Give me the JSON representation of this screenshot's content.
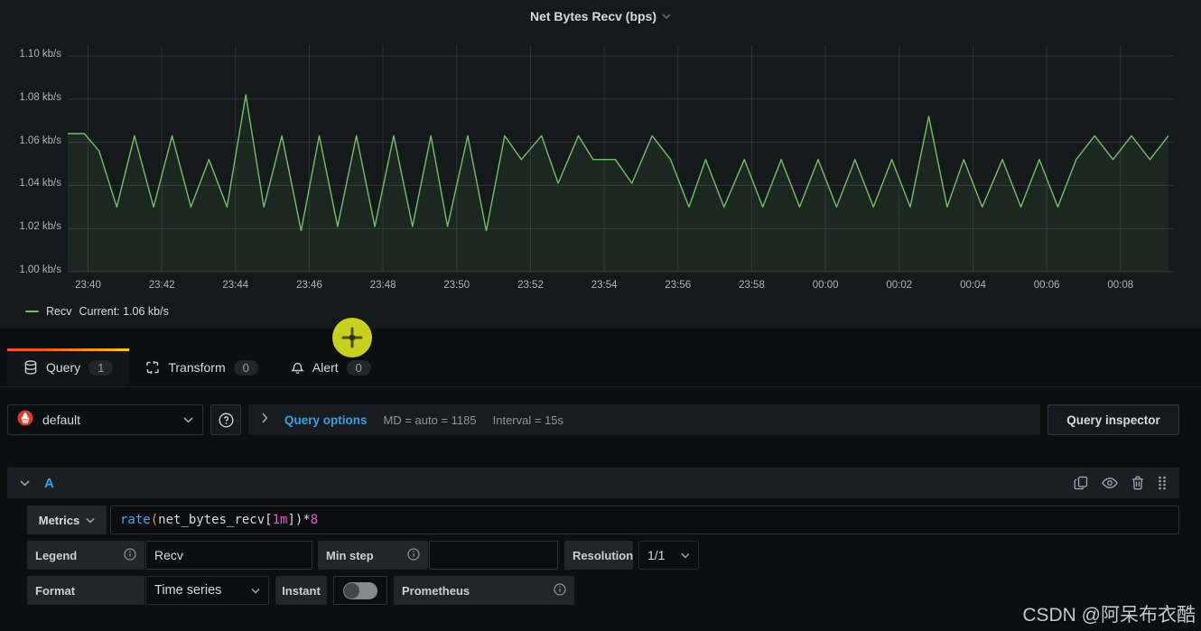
{
  "panel": {
    "title": "Net Bytes Recv (bps)",
    "legend_series": "Recv",
    "legend_current": "Current: 1.06 kb/s"
  },
  "chart_data": {
    "type": "line",
    "title": "Net Bytes Recv (bps)",
    "xlabel": "time",
    "ylabel": "kb/s",
    "grid": true,
    "legend_position": "bottom-left",
    "xlim": [
      -0.55,
      29.45
    ],
    "ylim": [
      1.0,
      1.1
    ],
    "x_unit": "minutes after 23:40",
    "x_ticks": [
      {
        "m": 0,
        "label": "23:40"
      },
      {
        "m": 2,
        "label": "23:42"
      },
      {
        "m": 4,
        "label": "23:44"
      },
      {
        "m": 6,
        "label": "23:46"
      },
      {
        "m": 8,
        "label": "23:48"
      },
      {
        "m": 10,
        "label": "23:50"
      },
      {
        "m": 12,
        "label": "23:52"
      },
      {
        "m": 14,
        "label": "23:54"
      },
      {
        "m": 16,
        "label": "23:56"
      },
      {
        "m": 18,
        "label": "23:58"
      },
      {
        "m": 20,
        "label": "00:00"
      },
      {
        "m": 22,
        "label": "00:02"
      },
      {
        "m": 24,
        "label": "00:04"
      },
      {
        "m": 26,
        "label": "00:06"
      },
      {
        "m": 28,
        "label": "00:08"
      }
    ],
    "y_ticks": [
      {
        "v": 1.1,
        "label": "1.10 kb/s"
      },
      {
        "v": 1.08,
        "label": "1.08 kb/s"
      },
      {
        "v": 1.06,
        "label": "1.06 kb/s"
      },
      {
        "v": 1.04,
        "label": "1.04 kb/s"
      },
      {
        "v": 1.02,
        "label": "1.02 kb/s"
      },
      {
        "v": 1.0,
        "label": "1.00 kb/s"
      }
    ],
    "series": [
      {
        "name": "Recv",
        "color": "#73bf69",
        "fill_opacity": 0.09,
        "current": "1.06 kb/s",
        "points": [
          [
            -0.55,
            1.064
          ],
          [
            -0.1,
            1.064
          ],
          [
            0.3,
            1.056
          ],
          [
            0.78,
            1.03
          ],
          [
            1.26,
            1.063
          ],
          [
            1.78,
            1.03
          ],
          [
            2.28,
            1.063
          ],
          [
            2.79,
            1.03
          ],
          [
            3.28,
            1.052
          ],
          [
            3.77,
            1.03
          ],
          [
            4.28,
            1.082
          ],
          [
            4.77,
            1.03
          ],
          [
            5.26,
            1.063
          ],
          [
            5.78,
            1.019
          ],
          [
            6.27,
            1.063
          ],
          [
            6.77,
            1.021
          ],
          [
            7.28,
            1.063
          ],
          [
            7.78,
            1.021
          ],
          [
            8.29,
            1.063
          ],
          [
            8.8,
            1.021
          ],
          [
            9.3,
            1.063
          ],
          [
            9.75,
            1.021
          ],
          [
            10.3,
            1.063
          ],
          [
            10.8,
            1.019
          ],
          [
            11.3,
            1.063
          ],
          [
            11.75,
            1.052
          ],
          [
            12.3,
            1.063
          ],
          [
            12.75,
            1.041
          ],
          [
            13.3,
            1.063
          ],
          [
            13.7,
            1.052
          ],
          [
            14.3,
            1.052
          ],
          [
            14.75,
            1.041
          ],
          [
            15.3,
            1.063
          ],
          [
            15.8,
            1.052
          ],
          [
            16.3,
            1.03
          ],
          [
            16.75,
            1.052
          ],
          [
            17.25,
            1.03
          ],
          [
            17.8,
            1.052
          ],
          [
            18.3,
            1.03
          ],
          [
            18.8,
            1.052
          ],
          [
            19.3,
            1.03
          ],
          [
            19.8,
            1.052
          ],
          [
            20.3,
            1.03
          ],
          [
            20.8,
            1.052
          ],
          [
            21.3,
            1.03
          ],
          [
            21.8,
            1.052
          ],
          [
            22.3,
            1.03
          ],
          [
            22.8,
            1.072
          ],
          [
            23.3,
            1.03
          ],
          [
            23.75,
            1.052
          ],
          [
            24.25,
            1.03
          ],
          [
            24.8,
            1.052
          ],
          [
            25.3,
            1.03
          ],
          [
            25.8,
            1.052
          ],
          [
            26.3,
            1.03
          ],
          [
            26.8,
            1.052
          ],
          [
            27.3,
            1.063
          ],
          [
            27.8,
            1.052
          ],
          [
            28.3,
            1.063
          ],
          [
            28.8,
            1.052
          ],
          [
            29.3,
            1.063
          ]
        ]
      }
    ]
  },
  "tabs": [
    {
      "label": "Query",
      "count": "1",
      "active": true
    },
    {
      "label": "Transform",
      "count": "0",
      "active": false
    },
    {
      "label": "Alert",
      "count": "0",
      "active": false
    }
  ],
  "datasource_bar": {
    "datasource": "default",
    "query_options_label": "Query options",
    "md_text": "MD = auto = 1185",
    "interval_text": "Interval = 15s",
    "inspector_label": "Query inspector"
  },
  "query_editor": {
    "ref_id": "A",
    "metrics_label": "Metrics",
    "expr_segments": [
      {
        "text": "rate",
        "color": "#45a9f5"
      },
      {
        "text": "(",
        "color": "#e9973f"
      },
      {
        "text": "net_bytes_recv",
        "color": "#d8d9da"
      },
      {
        "text": "[",
        "color": "#d8d9da"
      },
      {
        "text": "1m",
        "color": "#ff4dd2"
      },
      {
        "text": "]",
        "color": "#d8d9da"
      },
      {
        "text": ")",
        "color": "#d8d9da"
      },
      {
        "text": "*",
        "color": "#d8d9da"
      },
      {
        "text": "8",
        "color": "#ff4dd2"
      }
    ],
    "legend_label": "Legend",
    "legend_value": "Recv",
    "min_step_label": "Min step",
    "min_step_value": "",
    "resolution_label": "Resolution",
    "resolution_value": "1/1",
    "format_label": "Format",
    "format_value": "Time series",
    "instant_label": "Instant",
    "instant_on": false,
    "prometheus_label": "Prometheus"
  },
  "watermark": "CSDN @阿呆布衣酷"
}
